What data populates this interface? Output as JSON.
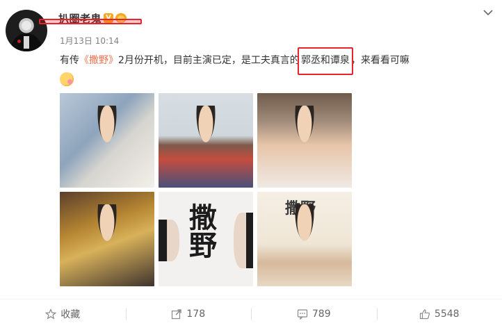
{
  "post": {
    "username": "扒圈老鬼",
    "vip_label": "V",
    "timestamp": "1月13日 10:14",
    "text_before": "有传",
    "hashtag": "《撒野》",
    "text_middle": "2月份开机，目前主演已定，是工夫真言的",
    "highlight_names": "郭丞和谭泉",
    "text_after": "，来看看可嘛",
    "emoji": "smiling-face-emoji",
    "images": [
      {
        "id": "photo-1",
        "calligraphy": ""
      },
      {
        "id": "photo-2",
        "calligraphy": ""
      },
      {
        "id": "photo-3",
        "calligraphy": ""
      },
      {
        "id": "photo-4",
        "calligraphy": ""
      },
      {
        "id": "photo-5",
        "calligraphy": "撒野"
      },
      {
        "id": "photo-6",
        "calligraphy": "撒野"
      }
    ]
  },
  "toolbar": {
    "favorite_label": "收藏",
    "repost_count": "178",
    "comment_count": "789",
    "like_count": "5548"
  },
  "colors": {
    "accent": "#eb7350",
    "highlight_box": "#e8232a",
    "vip": "#f7a71b"
  }
}
